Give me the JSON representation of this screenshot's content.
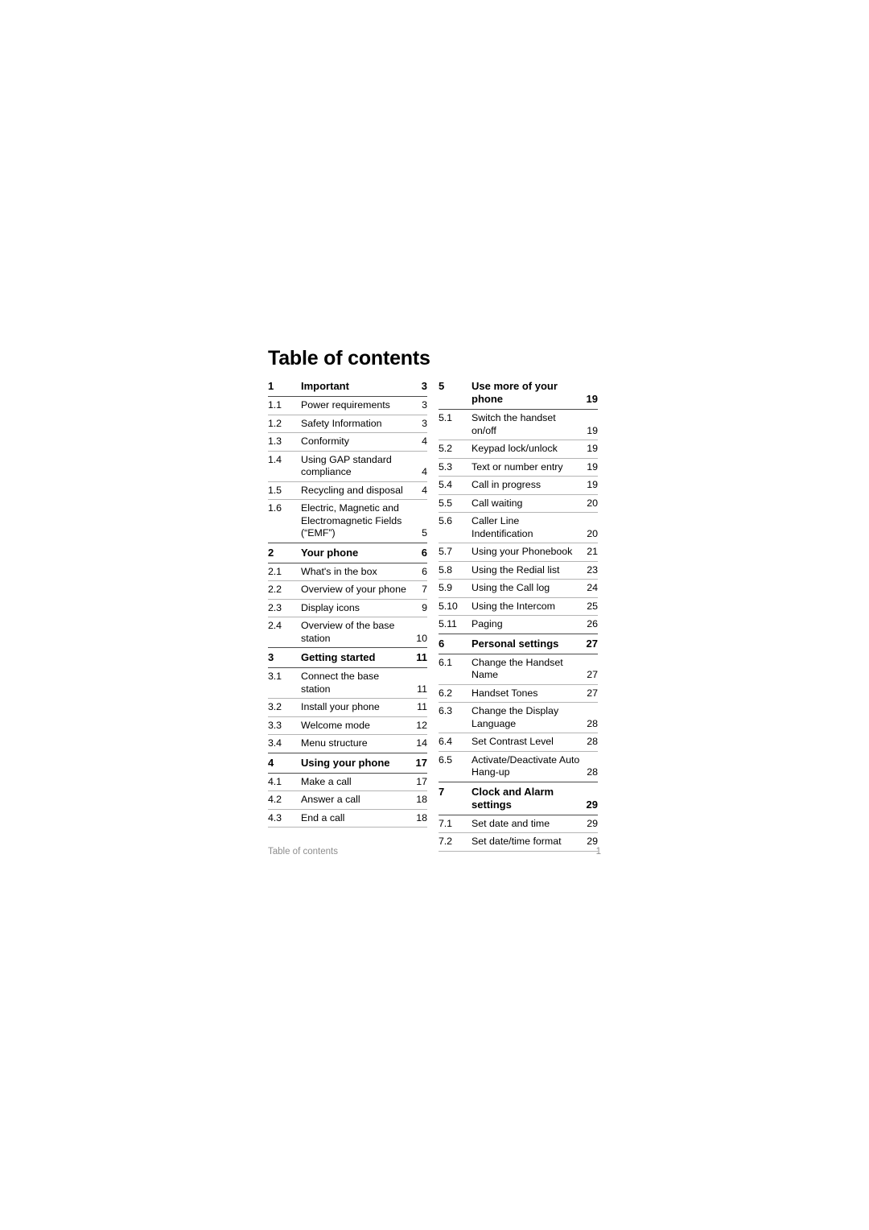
{
  "document": {
    "title": "Table of contents",
    "footer_left": "Table of contents",
    "footer_page": "1"
  },
  "toc": {
    "left_column": [
      {
        "type": "chapter",
        "num": "1",
        "label": "Important",
        "page": "3"
      },
      {
        "type": "entry",
        "num": "1.1",
        "label": "Power requirements",
        "page": "3"
      },
      {
        "type": "entry",
        "num": "1.2",
        "label": "Safety Information",
        "page": "3"
      },
      {
        "type": "entry",
        "num": "1.3",
        "label": "Conformity",
        "page": "4"
      },
      {
        "type": "entry",
        "num": "1.4",
        "label": "Using GAP standard compliance",
        "page": "4"
      },
      {
        "type": "entry",
        "num": "1.5",
        "label": "Recycling and disposal",
        "page": "4"
      },
      {
        "type": "entry",
        "num": "1.6",
        "label": "Electric, Magnetic and Electromagnetic Fields (“EMF”)",
        "page": "5"
      },
      {
        "type": "chapter",
        "num": "2",
        "label": "Your phone",
        "page": "6"
      },
      {
        "type": "entry",
        "num": "2.1",
        "label": "What's in the box",
        "page": "6"
      },
      {
        "type": "entry",
        "num": "2.2",
        "label": "Overview of your phone",
        "page": "7"
      },
      {
        "type": "entry",
        "num": "2.3",
        "label": "Display icons",
        "page": "9"
      },
      {
        "type": "entry",
        "num": "2.4",
        "label": "Overview of the base station",
        "page": "10"
      },
      {
        "type": "chapter",
        "num": "3",
        "label": "Getting started",
        "page": "11"
      },
      {
        "type": "entry",
        "num": "3.1",
        "label": "Connect the base station",
        "page": "11"
      },
      {
        "type": "entry",
        "num": "3.2",
        "label": "Install your phone",
        "page": "11"
      },
      {
        "type": "entry",
        "num": "3.3",
        "label": "Welcome mode",
        "page": "12"
      },
      {
        "type": "entry",
        "num": "3.4",
        "label": "Menu structure",
        "page": "14"
      },
      {
        "type": "chapter",
        "num": "4",
        "label": "Using your phone",
        "page": "17"
      },
      {
        "type": "entry",
        "num": "4.1",
        "label": "Make a call",
        "page": "17"
      },
      {
        "type": "entry",
        "num": "4.2",
        "label": "Answer a call",
        "page": "18"
      },
      {
        "type": "entry",
        "num": "4.3",
        "label": "End a call",
        "page": "18"
      }
    ],
    "right_column": [
      {
        "type": "chapter",
        "num": "5",
        "label": "Use more of your phone",
        "page": "19"
      },
      {
        "type": "entry",
        "num": "5.1",
        "label": "Switch the handset on/off",
        "page": "19"
      },
      {
        "type": "entry",
        "num": "5.2",
        "label": "Keypad lock/unlock",
        "page": "19"
      },
      {
        "type": "entry",
        "num": "5.3",
        "label": "Text or number entry",
        "page": "19"
      },
      {
        "type": "entry",
        "num": "5.4",
        "label": "Call in progress",
        "page": "19"
      },
      {
        "type": "entry",
        "num": "5.5",
        "label": "Call waiting",
        "page": "20"
      },
      {
        "type": "entry",
        "num": "5.6",
        "label": "Caller Line Indentification",
        "page": "20"
      },
      {
        "type": "entry",
        "num": "5.7",
        "label": "Using your Phonebook",
        "page": "21"
      },
      {
        "type": "entry",
        "num": "5.8",
        "label": "Using the Redial list",
        "page": "23"
      },
      {
        "type": "entry",
        "num": "5.9",
        "label": "Using the Call log",
        "page": "24"
      },
      {
        "type": "entry",
        "num": "5.10",
        "label": "Using the Intercom",
        "page": "25"
      },
      {
        "type": "entry",
        "num": "5.11",
        "label": "Paging",
        "page": "26"
      },
      {
        "type": "chapter",
        "num": "6",
        "label": "Personal settings",
        "page": "27"
      },
      {
        "type": "entry",
        "num": "6.1",
        "label": "Change the Handset Name",
        "page": "27"
      },
      {
        "type": "entry",
        "num": "6.2",
        "label": "Handset Tones",
        "page": "27"
      },
      {
        "type": "entry",
        "num": "6.3",
        "label": "Change the Display Language",
        "page": "28"
      },
      {
        "type": "entry",
        "num": "6.4",
        "label": "Set Contrast Level",
        "page": "28"
      },
      {
        "type": "entry",
        "num": "6.5",
        "label": "Activate/Deactivate Auto Hang-up",
        "page": "28"
      },
      {
        "type": "chapter",
        "num": "7",
        "label": "Clock and Alarm settings",
        "page": "29"
      },
      {
        "type": "entry",
        "num": "7.1",
        "label": "Set date and time",
        "page": "29"
      },
      {
        "type": "entry",
        "num": "7.2",
        "label": "Set date/time format",
        "page": "29"
      }
    ]
  }
}
